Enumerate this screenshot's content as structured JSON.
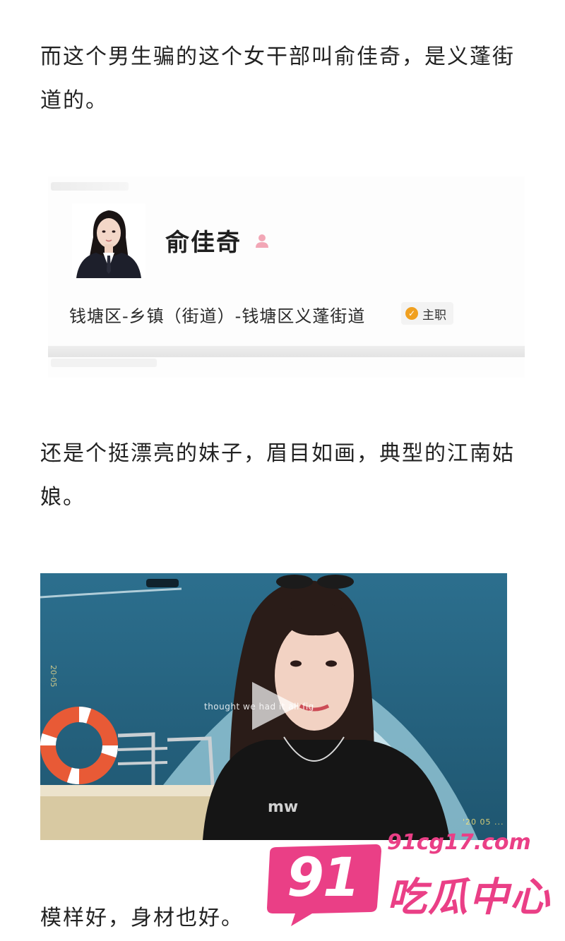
{
  "article": {
    "paragraph_1": "而这个男生骗的这个女干部叫俞佳奇，是义蓬街道的。",
    "paragraph_2": "还是个挺漂亮的妹子，眉目如画，典型的江南姑娘。",
    "paragraph_3": "模样好，身材也好。"
  },
  "profile": {
    "name": "俞佳奇",
    "organization": "钱塘区-乡镇（街道）-钱塘区义蓬街道",
    "badge": "主职",
    "avatar_icon": "avatar-photo",
    "badge_icon": "verified-check-icon",
    "name_icon": "person-icon"
  },
  "video": {
    "subtitle": "thought we had it all fig",
    "timestamp": "'20  05  ...",
    "play_icon": "play-icon"
  },
  "watermark": {
    "number": "91",
    "url": "91cg17.com",
    "name": "吃瓜中心"
  },
  "colors": {
    "text": "#222222",
    "watermark_pink": "#ea3f86",
    "badge_check": "#f0a020"
  }
}
